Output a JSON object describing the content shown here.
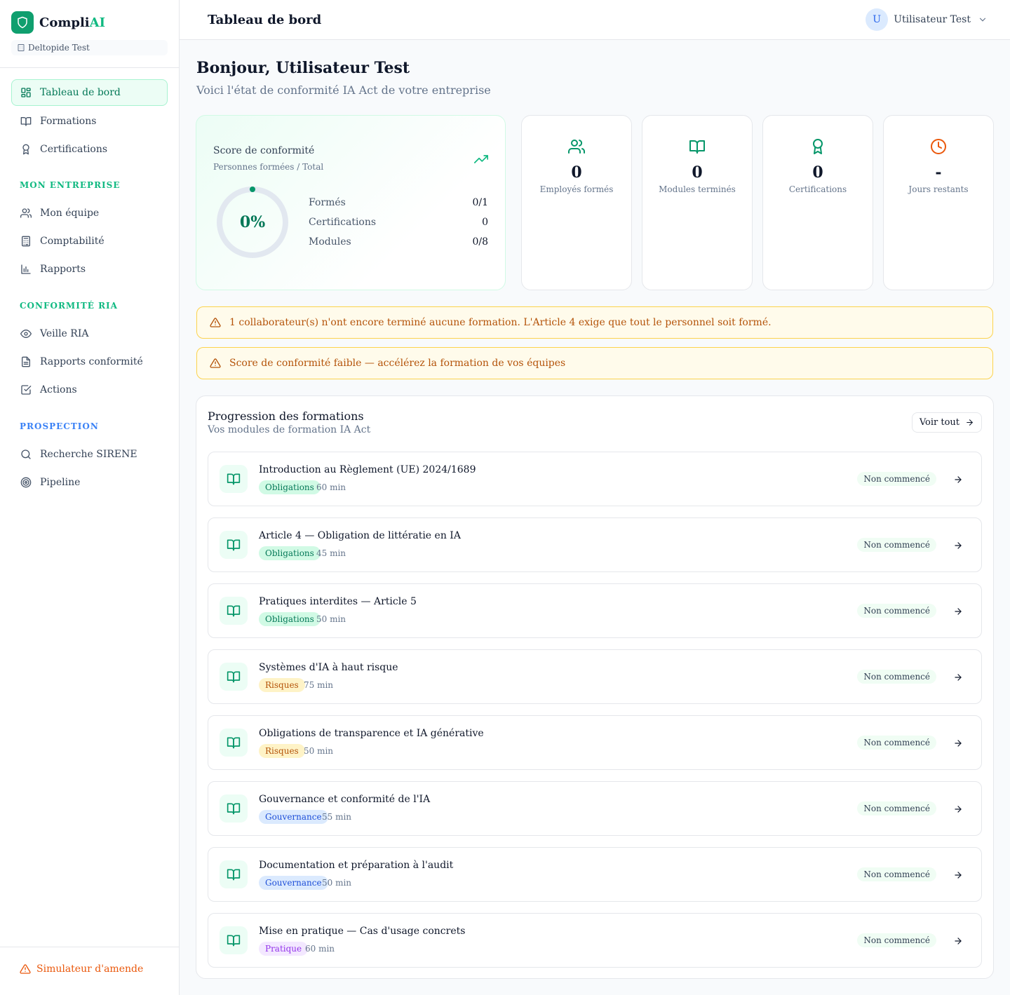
{
  "app": {
    "name_prefix": "Compli",
    "name_suffix": "AI",
    "org": "Deltopide Test"
  },
  "sidebar": {
    "items": [
      {
        "label": "Tableau de bord",
        "icon": "dashboard-icon",
        "active": true
      },
      {
        "label": "Formations",
        "icon": "book-open-icon"
      },
      {
        "label": "Certifications",
        "icon": "award-icon"
      }
    ],
    "sections": [
      {
        "label": "MON ENTREPRISE",
        "items": [
          {
            "label": "Mon équipe",
            "icon": "users-icon"
          },
          {
            "label": "Comptabilité",
            "icon": "calculator-icon"
          },
          {
            "label": "Rapports",
            "icon": "bar-chart-icon"
          }
        ]
      },
      {
        "label": "CONFORMITÉ RIA",
        "items": [
          {
            "label": "Veille RIA",
            "icon": "eye-icon"
          },
          {
            "label": "Rapports conformité",
            "icon": "file-text-icon"
          },
          {
            "label": "Actions",
            "icon": "check-square-icon"
          }
        ]
      },
      {
        "label": "PROSPECTION",
        "items": [
          {
            "label": "Recherche SIRENE",
            "icon": "search-icon"
          },
          {
            "label": "Pipeline",
            "icon": "target-icon"
          }
        ]
      }
    ],
    "footer": {
      "label": "Simulateur d'amende",
      "icon": "warning-icon"
    }
  },
  "header": {
    "title": "Tableau de bord",
    "user": "Utilisateur Test",
    "avatar_initial": "U"
  },
  "main": {
    "greeting": "Bonjour, Utilisateur Test",
    "subtitle": "Voici l'état de conformité IA Act de votre entreprise",
    "score": {
      "title": "Score de conformité",
      "subtitle": "Personnes formées / Total",
      "value": "0%",
      "percent": 0,
      "rows": [
        {
          "label": "Formés",
          "value": "0/1"
        },
        {
          "label": "Certifications",
          "value": "0"
        },
        {
          "label": "Modules",
          "value": "0/8"
        }
      ]
    },
    "stats": [
      {
        "value": "0",
        "label": "Employés formés",
        "icon": "users-icon",
        "color": "#059669"
      },
      {
        "value": "0",
        "label": "Modules terminés",
        "icon": "book-open-icon",
        "color": "#059669"
      },
      {
        "value": "0",
        "label": "Certifications",
        "icon": "award-icon",
        "color": "#059669"
      },
      {
        "value": "-",
        "label": "Jours restants",
        "icon": "clock-icon",
        "color": "#ea580c"
      }
    ],
    "alerts": [
      "1 collaborateur(s) n'ont encore terminé aucune formation. L'Article 4 exige que tout le personnel soit formé.",
      "Score de conformité faible — accélérez la formation de vos équipes"
    ],
    "progress": {
      "title": "Progression des formations",
      "subtitle": "Vos modules de formation IA Act",
      "see_all": "Voir tout",
      "modules": [
        {
          "title": "Introduction au Règlement (UE) 2024/1689",
          "tag": "Obligations",
          "tag_color": "green",
          "duration": "60 min",
          "status": "Non commencé"
        },
        {
          "title": "Article 4 — Obligation de littératie en IA",
          "tag": "Obligations",
          "tag_color": "green",
          "duration": "45 min",
          "status": "Non commencé"
        },
        {
          "title": "Pratiques interdites — Article 5",
          "tag": "Obligations",
          "tag_color": "green",
          "duration": "50 min",
          "status": "Non commencé"
        },
        {
          "title": "Systèmes d'IA à haut risque",
          "tag": "Risques",
          "tag_color": "amber",
          "duration": "75 min",
          "status": "Non commencé"
        },
        {
          "title": "Obligations de transparence et IA générative",
          "tag": "Risques",
          "tag_color": "amber",
          "duration": "50 min",
          "status": "Non commencé"
        },
        {
          "title": "Gouvernance et conformité de l'IA",
          "tag": "Gouvernance",
          "tag_color": "blue",
          "duration": "55 min",
          "status": "Non commencé"
        },
        {
          "title": "Documentation et préparation à l'audit",
          "tag": "Gouvernance",
          "tag_color": "blue",
          "duration": "50 min",
          "status": "Non commencé"
        },
        {
          "title": "Mise en pratique — Cas d'usage concrets",
          "tag": "Pratique",
          "tag_color": "purple",
          "duration": "60 min",
          "status": "Non commencé"
        }
      ]
    }
  }
}
